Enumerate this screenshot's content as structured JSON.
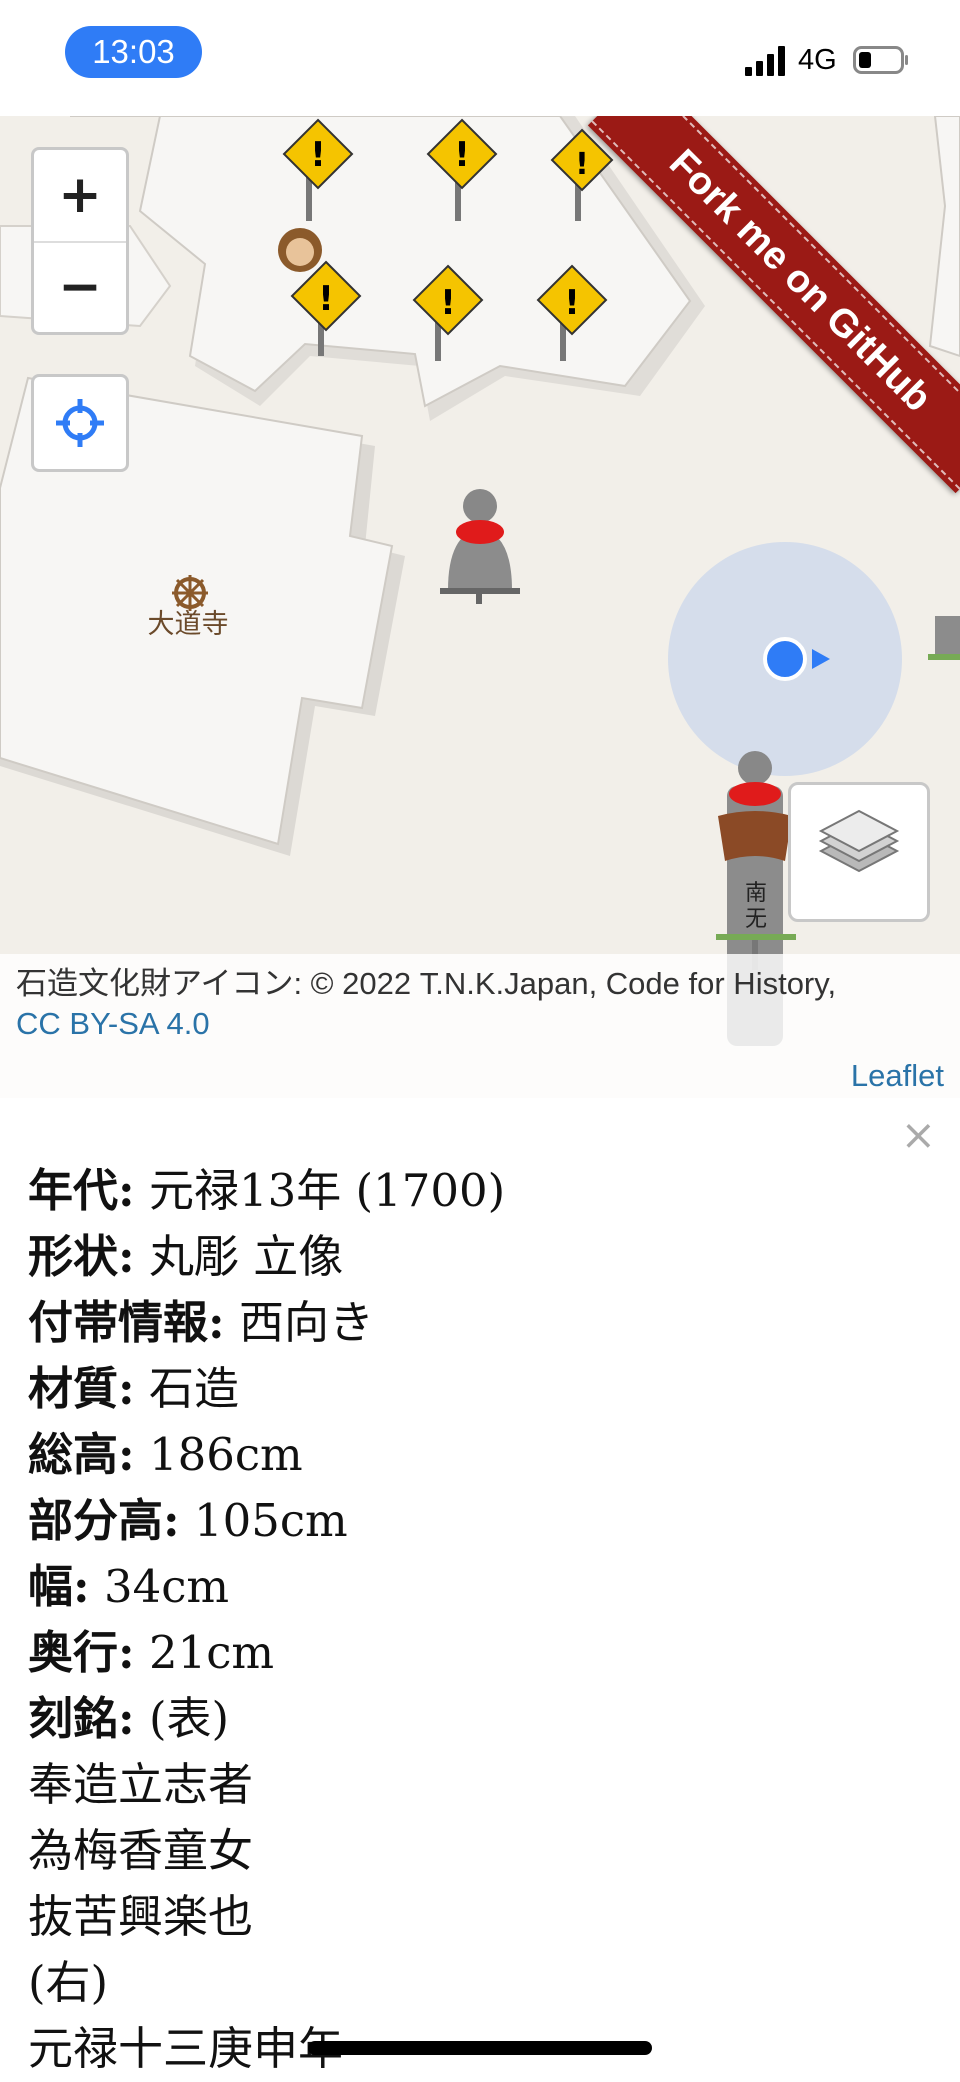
{
  "status_bar": {
    "time": "13:03",
    "network": "4G",
    "signal_icon": "cellular-signal-icon",
    "battery_icon": "battery-low-icon"
  },
  "map": {
    "zoom_in_label": "+",
    "zoom_out_label": "−",
    "locate_icon": "locate-crosshair-icon",
    "layers_icon": "layers-icon",
    "temple_label": "大道寺",
    "temple_icon": "dharma-wheel-icon",
    "ribbon_text": "Fork me on GitHub",
    "attribution_text": "石造文化財アイコン: © 2022 T.N.K.Japan, Code for History,",
    "attribution_license": "CC BY-SA 4.0",
    "leaflet_link": "Leaflet",
    "colors": {
      "ribbon": "#9b1a15",
      "location_dot": "#2f7cf6",
      "link": "#2a73a8"
    }
  },
  "info": {
    "close_label": "×",
    "rows": [
      {
        "label": "年代:",
        "value": "元禄13年 (1700)"
      },
      {
        "label": "形状:",
        "value": "丸彫 立像"
      },
      {
        "label": "付帯情報:",
        "value": "西向き"
      },
      {
        "label": "材質:",
        "value": "石造"
      },
      {
        "label": "総高:",
        "value": "186cm"
      },
      {
        "label": "部分高:",
        "value": "105cm"
      },
      {
        "label": "幅:",
        "value": "34cm"
      },
      {
        "label": "奥行:",
        "value": "21cm"
      },
      {
        "label": "刻銘:",
        "value": "(表)"
      }
    ],
    "inscription_lines": [
      "奉造立志者",
      "為梅香童女",
      "抜苦興楽也",
      "(右)",
      "元禄十三庚申年"
    ]
  }
}
